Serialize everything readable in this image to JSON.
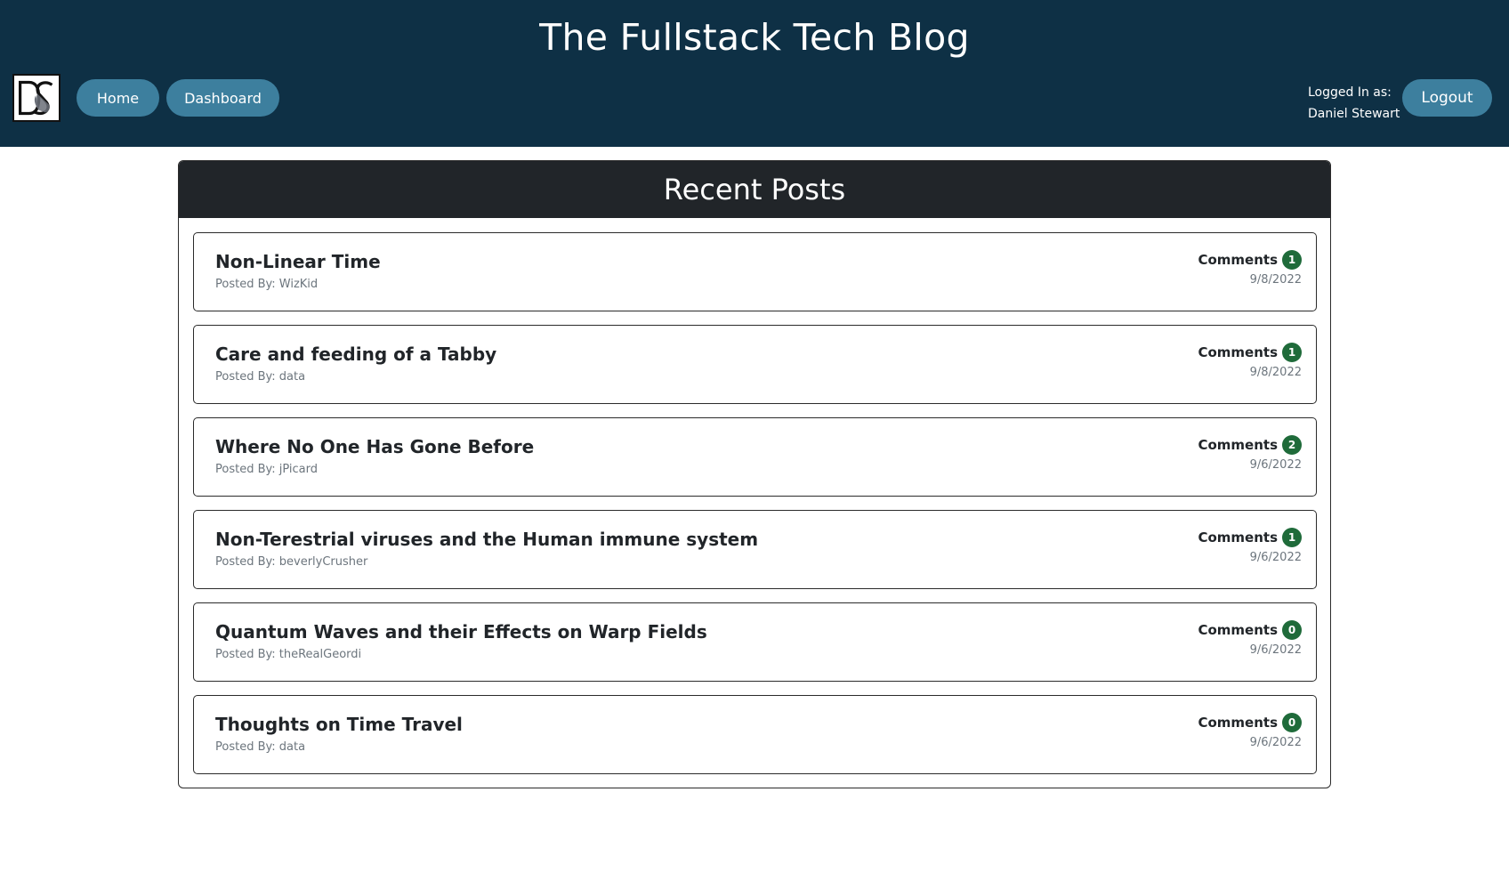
{
  "header": {
    "title": "The Fullstack Tech Blog",
    "logo_text": "DS",
    "nav": [
      {
        "label": "Home"
      },
      {
        "label": "Dashboard"
      }
    ],
    "logged_in_label": "Logged In as:",
    "username": "Daniel Stewart",
    "logout_label": "Logout"
  },
  "main": {
    "heading": "Recent Posts",
    "comments_label": "Comments",
    "posts": [
      {
        "title": "Non-Linear Time",
        "author": "Posted By: WizKid",
        "comments": "1",
        "date": "9/8/2022"
      },
      {
        "title": "Care and feeding of a Tabby",
        "author": "Posted By: data",
        "comments": "1",
        "date": "9/8/2022"
      },
      {
        "title": "Where No One Has Gone Before",
        "author": "Posted By: jPicard",
        "comments": "2",
        "date": "9/6/2022"
      },
      {
        "title": "Non-Terestrial viruses and the Human immune system",
        "author": "Posted By: beverlyCrusher",
        "comments": "1",
        "date": "9/6/2022"
      },
      {
        "title": "Quantum Waves and their Effects on Warp Fields",
        "author": "Posted By: theRealGeordi",
        "comments": "0",
        "date": "9/6/2022"
      },
      {
        "title": "Thoughts on Time Travel",
        "author": "Posted By: data",
        "comments": "0",
        "date": "9/6/2022"
      }
    ]
  },
  "colors": {
    "header_bg": "#0e3045",
    "button_bg": "#3d7f9e",
    "panel_header_bg": "#212529",
    "badge_bg": "#1f6b3a"
  }
}
